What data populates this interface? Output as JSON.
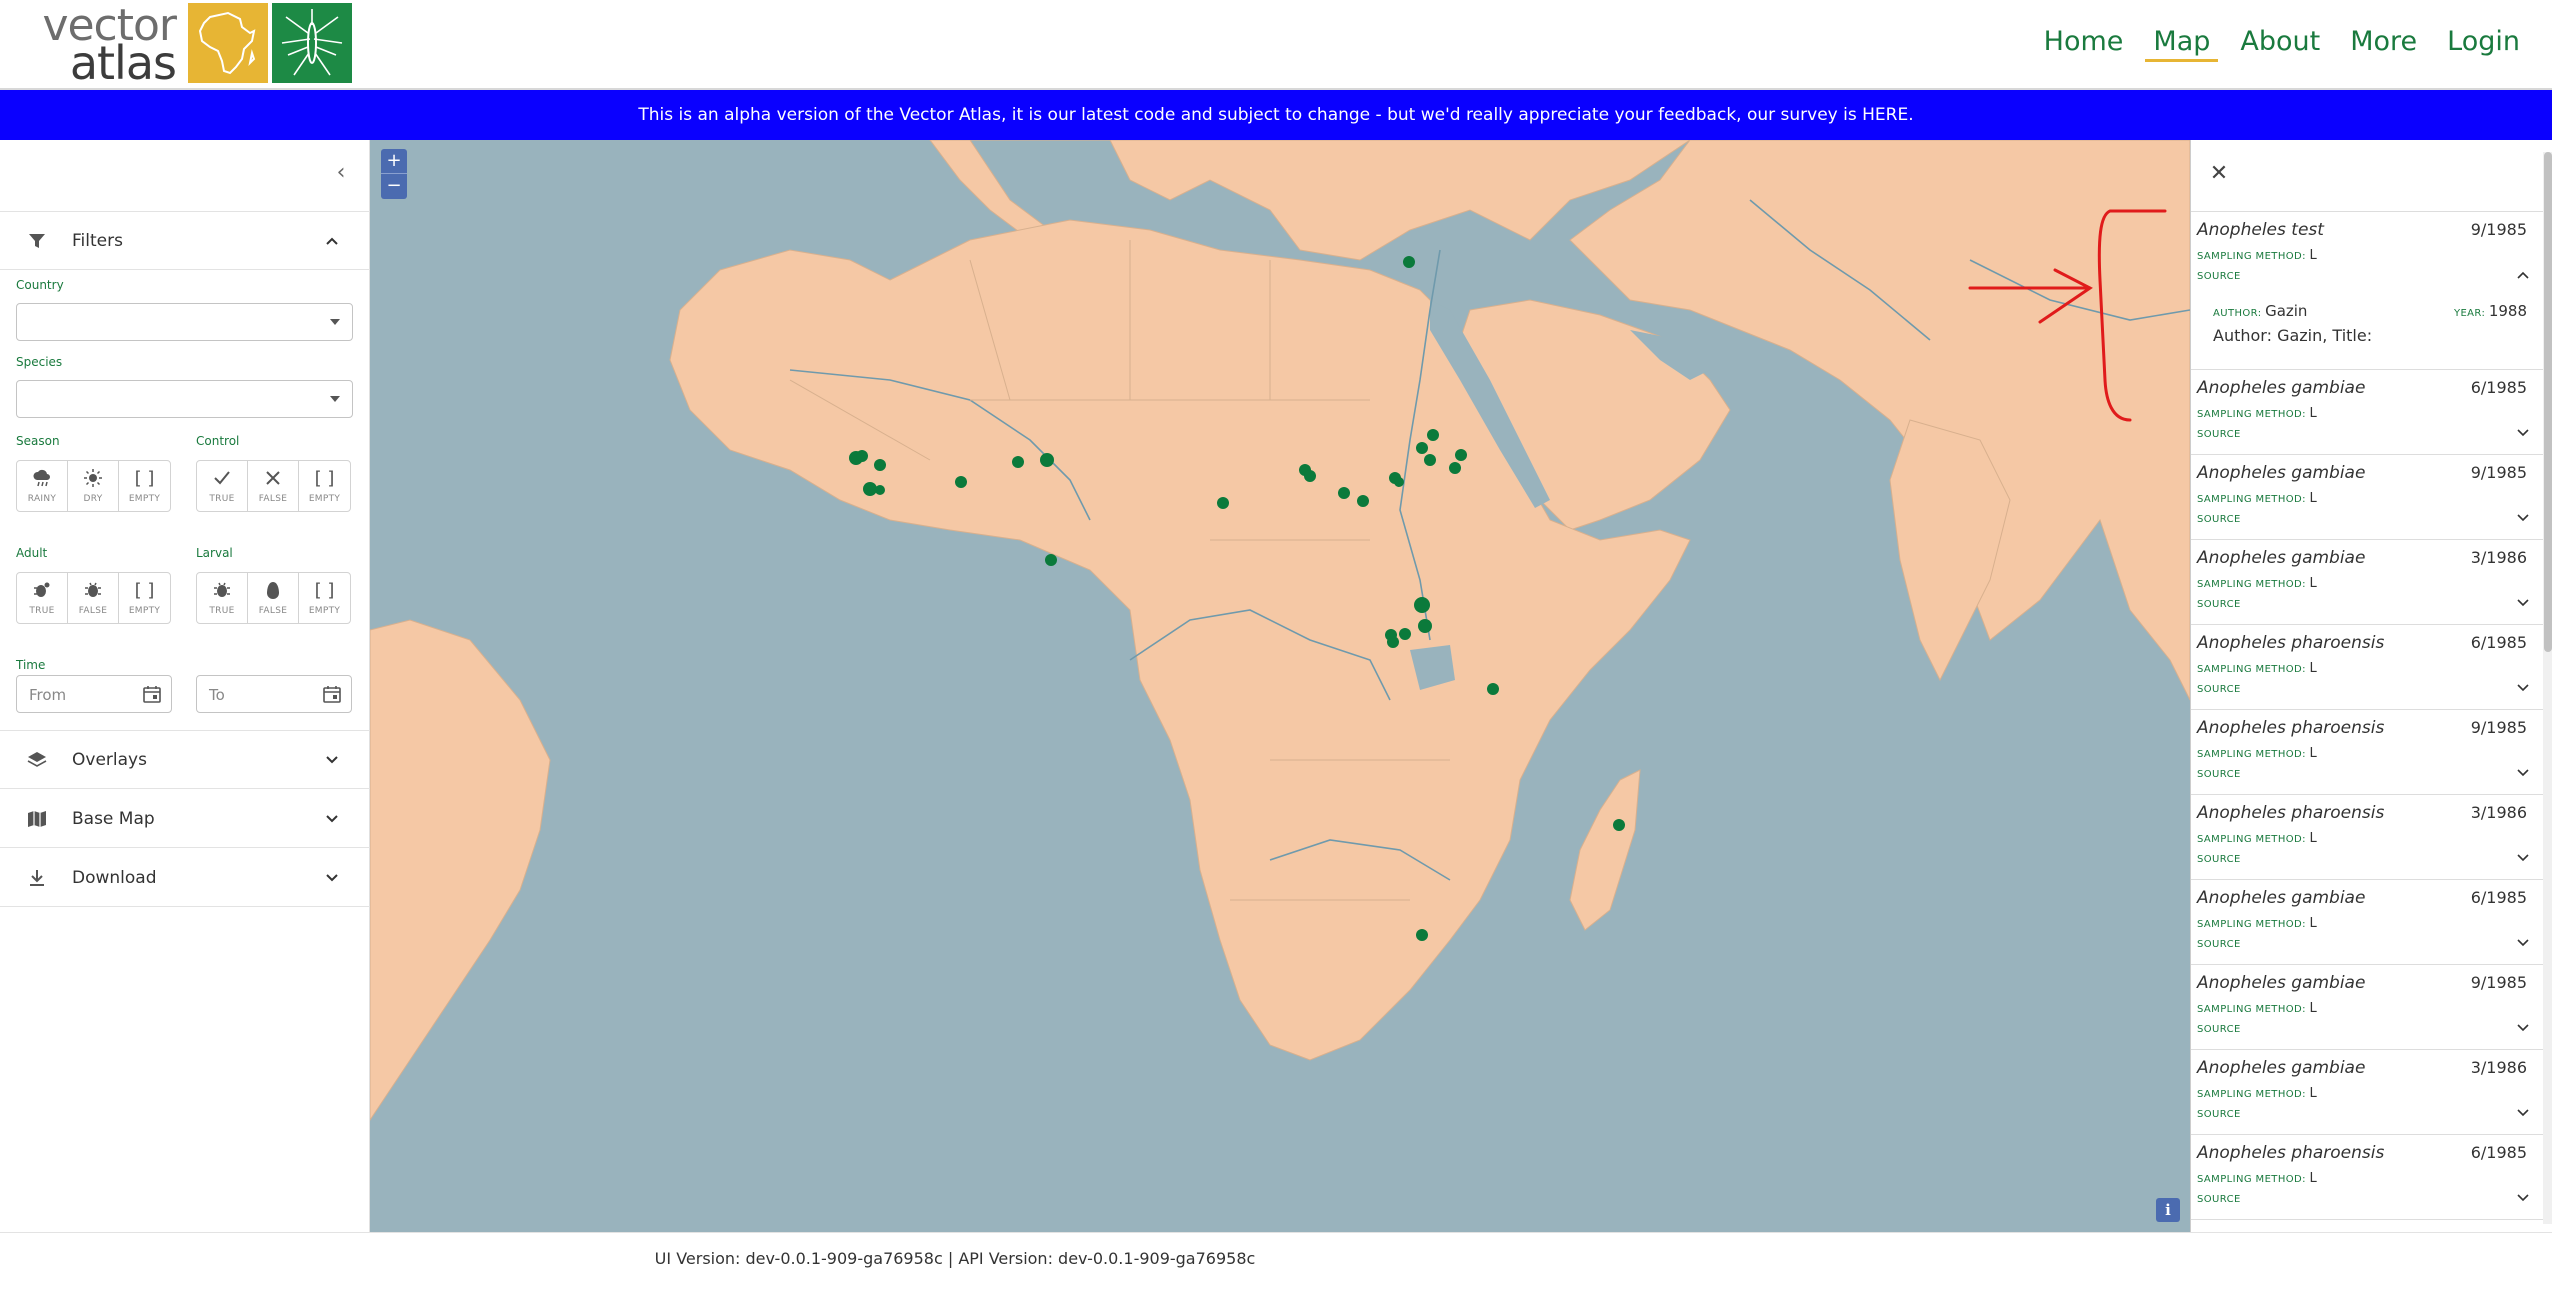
{
  "logo": {
    "line1": "vector",
    "line2": "atlas"
  },
  "nav": [
    {
      "label": "Home",
      "active": false
    },
    {
      "label": "Map",
      "active": true
    },
    {
      "label": "About",
      "active": false
    },
    {
      "label": "More",
      "active": false
    },
    {
      "label": "Login",
      "active": false
    }
  ],
  "banner": {
    "text": "This is an alpha version of the Vector Atlas, it is our latest code and subject to change - but we'd really appreciate your feedback, our survey is HERE."
  },
  "sidebar": {
    "filters": {
      "title": "Filters",
      "country_label": "Country",
      "species_label": "Species",
      "season_label": "Season",
      "control_label": "Control",
      "adult_label": "Adult",
      "larval_label": "Larval",
      "time_label": "Time",
      "season_options": [
        "RAINY",
        "DRY",
        "EMPTY"
      ],
      "control_options": [
        "TRUE",
        "FALSE",
        "EMPTY"
      ],
      "adult_options": [
        "TRUE",
        "FALSE",
        "EMPTY"
      ],
      "larval_options": [
        "TRUE",
        "FALSE",
        "EMPTY"
      ],
      "from_placeholder": "From",
      "to_placeholder": "To"
    },
    "overlays_title": "Overlays",
    "basemap_title": "Base Map",
    "download_title": "Download"
  },
  "map": {
    "zoom_in": "+",
    "zoom_out": "−",
    "info": "i",
    "colors": {
      "water": "#99b3bd",
      "land": "#f5c8a5",
      "marker": "#0b7a3b"
    }
  },
  "panel": {
    "sampling_label": "SAMPLING METHOD:",
    "source_label": "SOURCE",
    "author_label": "AUTHOR:",
    "year_label": "YEAR:",
    "records": [
      {
        "species": "Anopheles test",
        "date": "9/1985",
        "sampling": "L",
        "expanded": true,
        "author": "Gazin",
        "year": "1988",
        "detail": "Author: Gazin, Title:"
      },
      {
        "species": "Anopheles gambiae",
        "date": "6/1985",
        "sampling": "L"
      },
      {
        "species": "Anopheles gambiae",
        "date": "9/1985",
        "sampling": "L"
      },
      {
        "species": "Anopheles gambiae",
        "date": "3/1986",
        "sampling": "L"
      },
      {
        "species": "Anopheles pharoensis",
        "date": "6/1985",
        "sampling": "L"
      },
      {
        "species": "Anopheles pharoensis",
        "date": "9/1985",
        "sampling": "L"
      },
      {
        "species": "Anopheles pharoensis",
        "date": "3/1986",
        "sampling": "L"
      },
      {
        "species": "Anopheles gambiae",
        "date": "6/1985",
        "sampling": "L"
      },
      {
        "species": "Anopheles gambiae",
        "date": "9/1985",
        "sampling": "L"
      },
      {
        "species": "Anopheles gambiae",
        "date": "3/1986",
        "sampling": "L"
      },
      {
        "species": "Anopheles pharoensis",
        "date": "6/1985",
        "sampling": "L"
      }
    ]
  },
  "footer": {
    "text": "UI Version: dev-0.0.1-909-ga76958c | API Version: dev-0.0.1-909-ga76958c"
  }
}
